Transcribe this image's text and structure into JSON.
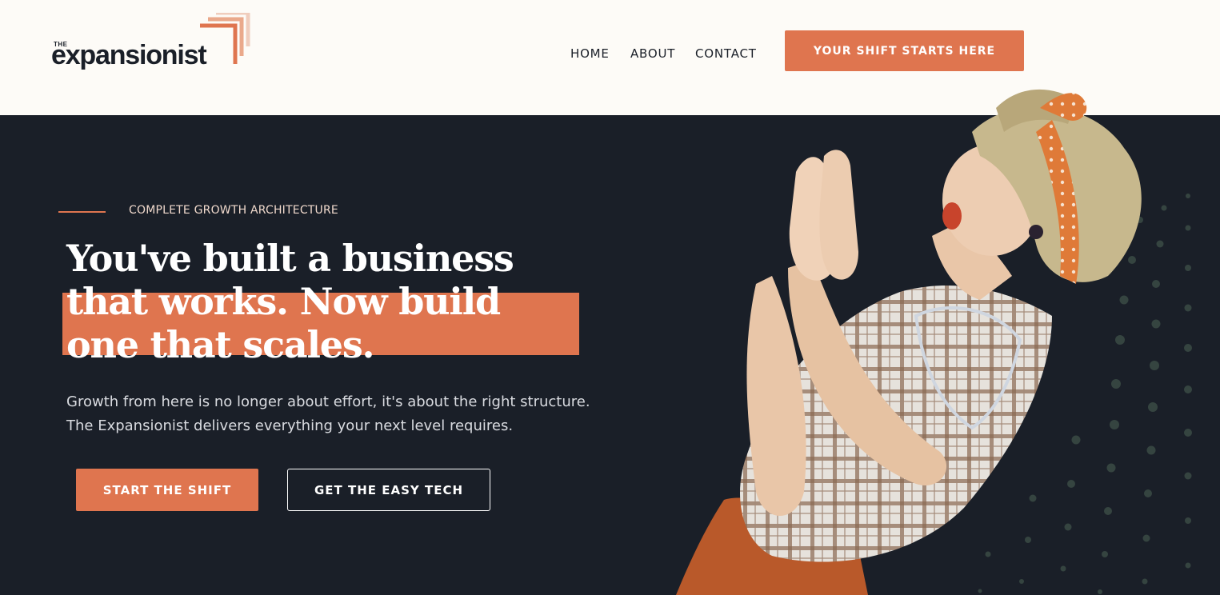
{
  "header": {
    "logo": {
      "small_text": "THE",
      "word": "expansionist"
    },
    "nav": [
      {
        "label": "HOME"
      },
      {
        "label": "ABOUT"
      },
      {
        "label": "CONTACT"
      }
    ],
    "cta_label": "YOUR SHIFT STARTS HERE"
  },
  "hero": {
    "eyebrow": "COMPLETE GROWTH ARCHITECTURE",
    "headline_lines": [
      "You've built a business",
      "that works. Now build",
      "one that scales."
    ],
    "subtext_lines": [
      "Growth from here is no longer about effort, it's about the right structure.",
      "The Expansionist delivers everything your next level requires."
    ],
    "primary_button": "START THE SHIFT",
    "secondary_button": "GET THE EASY TECH",
    "image_subject": "retro-woman-clapping-illustration"
  },
  "colors": {
    "accent": "#df754f",
    "dark": "#1a1f28",
    "header_bg": "#fdfbf7",
    "dots": "#3a4a48"
  }
}
